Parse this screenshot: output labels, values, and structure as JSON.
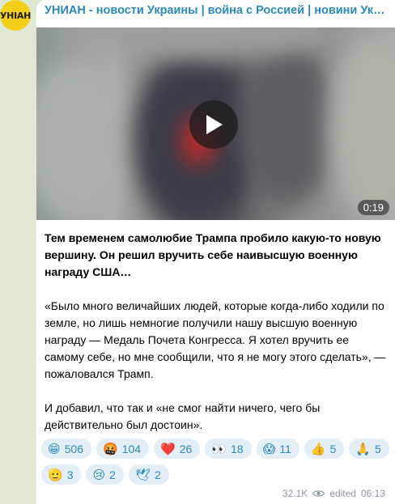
{
  "channel": {
    "avatar_text": "УНIAН",
    "title": "УНИАН - новости Украины | война с Россией | новини Україні..."
  },
  "video": {
    "duration": "0:19"
  },
  "message": {
    "paragraphs": [
      "Тем временем самолюбие Трампа пробило какую-то новую вершину. Он решил вручить себе наивысшую военную награду США…",
      "«Было много величайших людей, которые когда-либо ходили по земле, но лишь немногие получили нашу высшую военную награду — Медаль Почета Конгресса. Я хотел вручить ее самому себе, но мне сообщили, что я не могу этого сделать», — пожаловался Трамп.",
      "И добавил, что так и «не смог найти ничего, чего бы действительно был достоин»."
    ]
  },
  "reactions": [
    {
      "emoji": "😁",
      "count": "506"
    },
    {
      "emoji": "🤬",
      "count": "104"
    },
    {
      "emoji": "❤️",
      "count": "26"
    },
    {
      "emoji": "👀",
      "count": "18"
    },
    {
      "emoji": "😱",
      "count": "11"
    },
    {
      "emoji": "👍",
      "count": "5"
    },
    {
      "emoji": "🙏",
      "count": "5"
    },
    {
      "emoji": "🫡",
      "count": "3"
    },
    {
      "emoji": "😢",
      "count": "2"
    },
    {
      "emoji": "🕊",
      "count": "2"
    }
  ],
  "meta": {
    "views": "32.1K",
    "edited_label": "edited",
    "time": "06:13"
  },
  "colors": {
    "accent": "#2b8ab7",
    "reaction_bg": "#e3eef7",
    "chat_bg": "#dfe8d3",
    "avatar_bg": "#f4cf1a"
  }
}
